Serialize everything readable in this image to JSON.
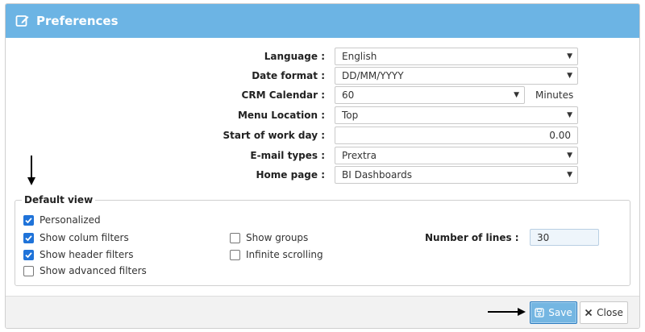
{
  "dialog": {
    "title": "Preferences",
    "icon": "edit-icon"
  },
  "form": {
    "language": {
      "label": "Language :",
      "value": "English"
    },
    "date_format": {
      "label": "Date format :",
      "value": "DD/MM/YYYY"
    },
    "crm_calendar": {
      "label": "CRM Calendar :",
      "value": "60",
      "suffix": "Minutes"
    },
    "menu_location": {
      "label": "Menu Location :",
      "value": "Top"
    },
    "start_of_work_day": {
      "label": "Start of work day :",
      "value": "0.00"
    },
    "email_types": {
      "label": "E-mail types :",
      "value": "Prextra"
    },
    "home_page": {
      "label": "Home page :",
      "value": "BI Dashboards"
    }
  },
  "default_view": {
    "legend": "Default view",
    "personalized": {
      "label": "Personalized",
      "checked": true
    },
    "show_column_filters": {
      "label": "Show colum filters",
      "checked": true
    },
    "show_header_filters": {
      "label": "Show header filters",
      "checked": true
    },
    "show_advanced_filters": {
      "label": "Show advanced filters",
      "checked": false
    },
    "show_groups": {
      "label": "Show groups",
      "checked": false
    },
    "infinite_scrolling": {
      "label": "Infinite scrolling",
      "checked": false
    },
    "number_of_lines": {
      "label": "Number of lines :",
      "value": "30"
    }
  },
  "footer": {
    "save_label": "Save",
    "close_label": "Close"
  },
  "colors": {
    "header": "#6cb4e4",
    "checkbox": "#1f73d9",
    "save_button": "#74b6e2"
  }
}
